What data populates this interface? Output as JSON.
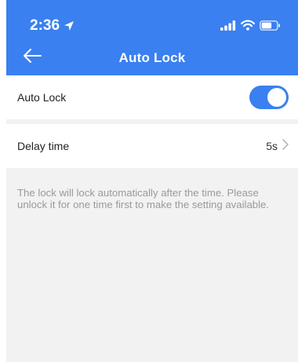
{
  "status_bar": {
    "time": "2:36",
    "icons": [
      "location-arrow-icon",
      "signal-icon",
      "wifi-icon",
      "battery-icon"
    ]
  },
  "nav": {
    "back_icon": "arrow-left-icon",
    "title": "Auto Lock"
  },
  "settings": {
    "auto_lock": {
      "label": "Auto Lock",
      "enabled": true
    },
    "delay_time": {
      "label": "Delay time",
      "value": "5s",
      "icon": "chevron-right-icon"
    }
  },
  "note": "The lock will lock automatically after the time. Please unlock it for one time first to make the setting available.",
  "colors": {
    "accent": "#3a80f0",
    "background": "#f2f2f2",
    "note_text": "#9a9a9a"
  }
}
